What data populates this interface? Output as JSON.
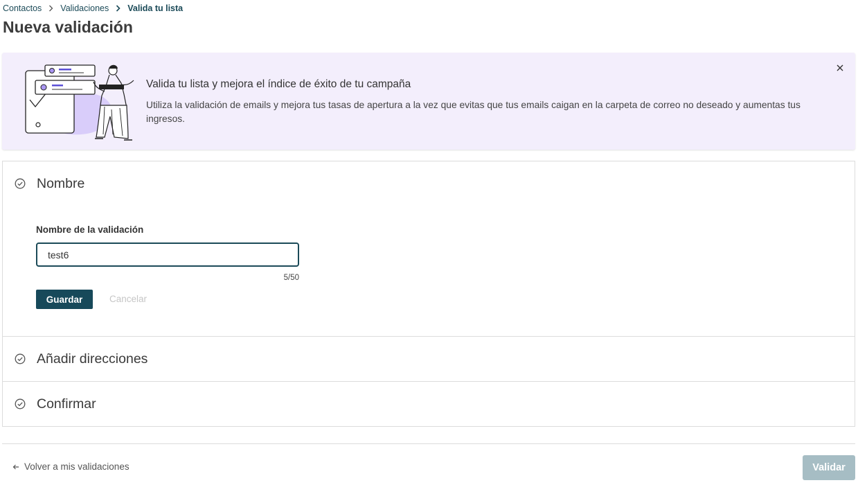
{
  "breadcrumb": {
    "items": [
      "Contactos",
      "Validaciones"
    ],
    "current": "Valida tu lista"
  },
  "page": {
    "title": "Nueva validación"
  },
  "banner": {
    "title": "Valida tu lista y mejora el índice de éxito de tu campaña",
    "text": "Utiliza la validación de emails y mejora tus tasas de apertura a la vez que evitas que tus emails caigan en la carpeta de correo no deseado y aumentas tus ingresos.",
    "close_icon": "close-icon",
    "background": "#f3eefc"
  },
  "steps": [
    {
      "label": "Nombre",
      "icon": "check-circle-icon"
    },
    {
      "label": "Añadir direcciones",
      "icon": "check-circle-icon"
    },
    {
      "label": "Confirmar",
      "icon": "check-circle-icon"
    }
  ],
  "name_form": {
    "label": "Nombre de la validación",
    "value": "test6",
    "counter": "5/50",
    "save_label": "Guardar",
    "cancel_label": "Cancelar"
  },
  "footer": {
    "back_label": "Volver a mis validaciones",
    "validate_label": "Validar"
  },
  "colors": {
    "primary": "#17495a",
    "disabled_button": "#a6bdc4",
    "banner_bg": "#f3eefc",
    "border": "#dcdcdc"
  }
}
